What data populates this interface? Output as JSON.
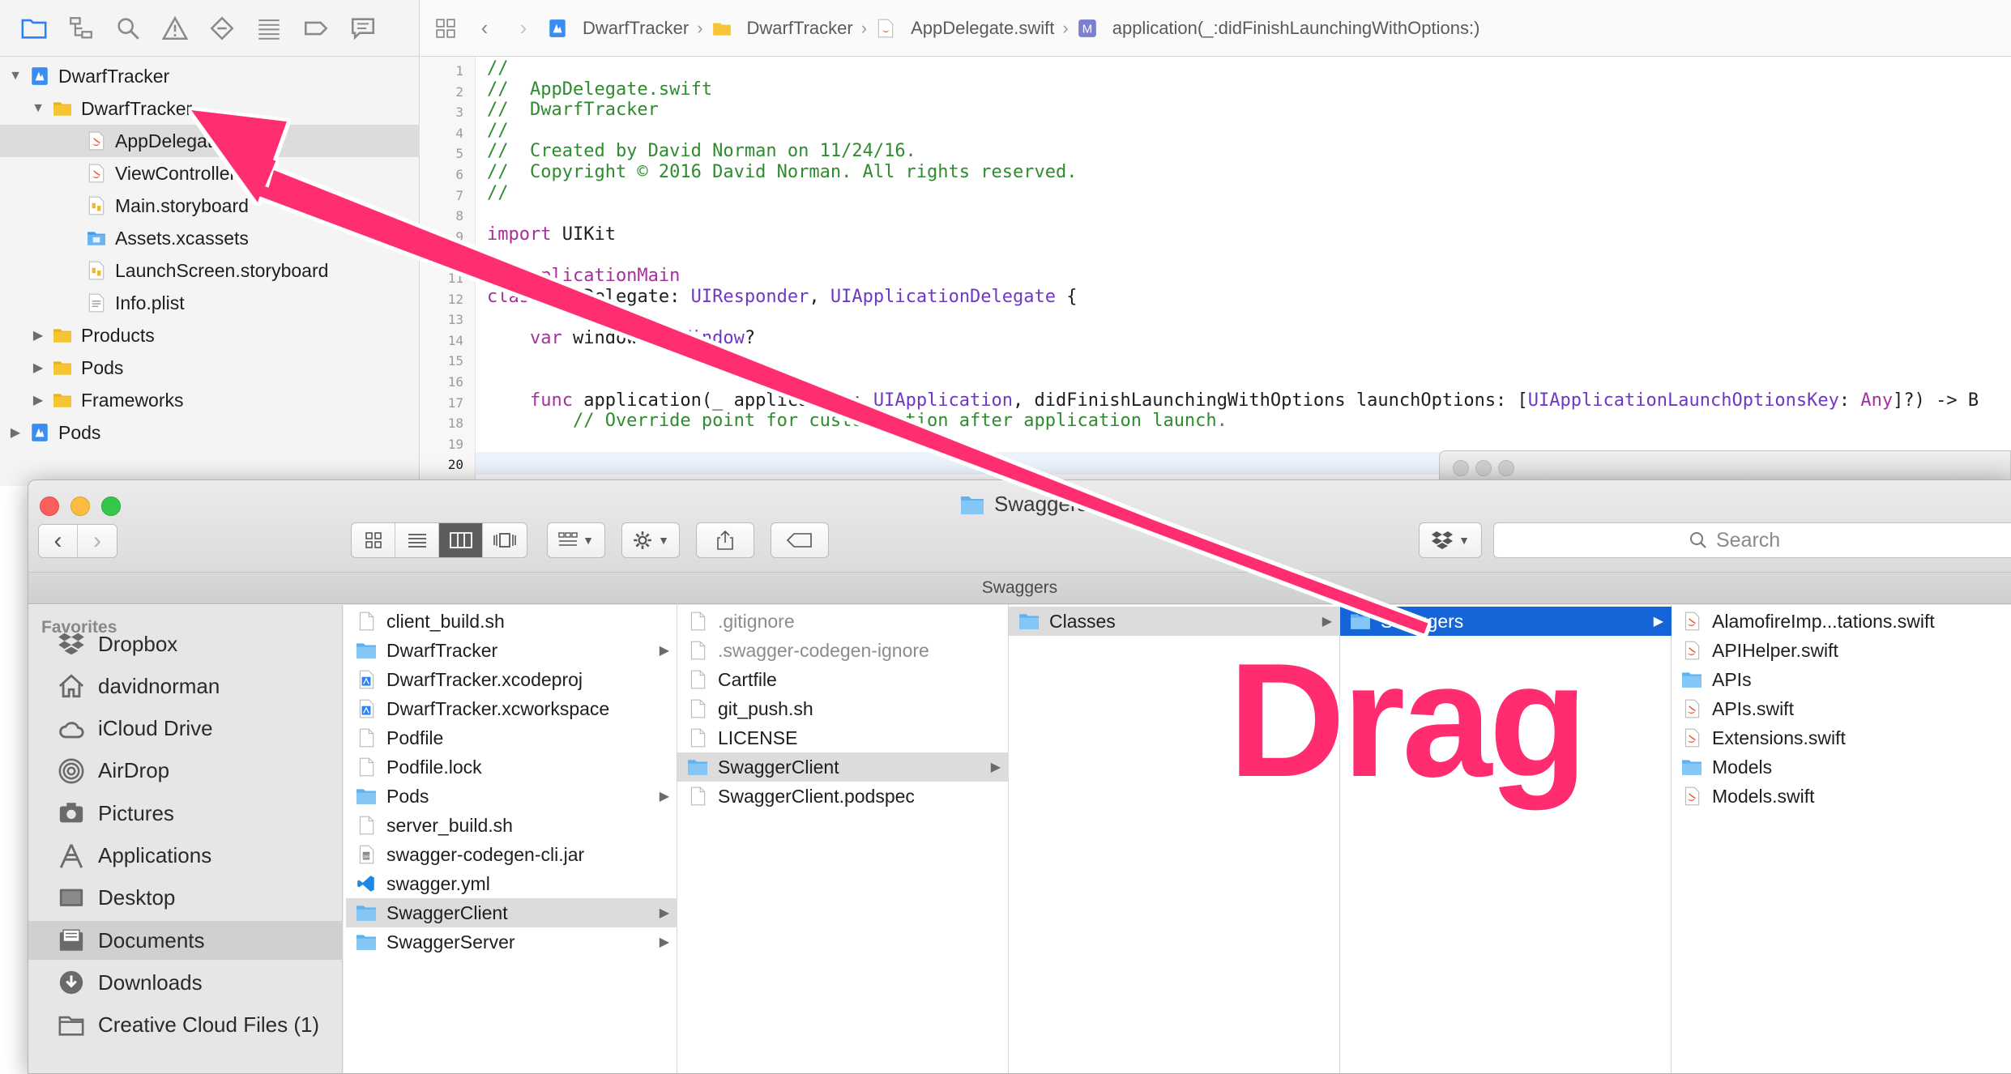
{
  "xcode": {
    "tree": [
      {
        "label": "DwarfTracker",
        "level": 0,
        "disclosure": "open",
        "icon": "project-icon"
      },
      {
        "label": "DwarfTracker",
        "level": 1,
        "disclosure": "open",
        "icon": "folder-icon"
      },
      {
        "label": "AppDelegate.swift",
        "level": 2,
        "disclosure": "",
        "icon": "swift-file-icon",
        "selected": true
      },
      {
        "label": "ViewController.swift",
        "level": 2,
        "disclosure": "",
        "icon": "swift-file-icon"
      },
      {
        "label": "Main.storyboard",
        "level": 2,
        "disclosure": "",
        "icon": "storyboard-icon"
      },
      {
        "label": "Assets.xcassets",
        "level": 2,
        "disclosure": "",
        "icon": "assets-folder-icon"
      },
      {
        "label": "LaunchScreen.storyboard",
        "level": 2,
        "disclosure": "",
        "icon": "storyboard-icon"
      },
      {
        "label": "Info.plist",
        "level": 2,
        "disclosure": "",
        "icon": "plist-icon"
      },
      {
        "label": "Products",
        "level": 1,
        "disclosure": "closed",
        "icon": "folder-icon"
      },
      {
        "label": "Pods",
        "level": 1,
        "disclosure": "closed",
        "icon": "folder-icon"
      },
      {
        "label": "Frameworks",
        "level": 1,
        "disclosure": "closed",
        "icon": "folder-icon"
      },
      {
        "label": "Pods",
        "level": 0,
        "disclosure": "closed",
        "icon": "project-icon"
      }
    ],
    "breadcrumb": [
      "DwarfTracker",
      "DwarfTracker",
      "AppDelegate.swift",
      "application(_:didFinishLaunchingWithOptions:)"
    ],
    "current_line": 20,
    "code": [
      {
        "n": 1,
        "parts": [
          [
            "c",
            "//"
          ]
        ]
      },
      {
        "n": 2,
        "parts": [
          [
            "c",
            "//  AppDelegate.swift"
          ]
        ]
      },
      {
        "n": 3,
        "parts": [
          [
            "c",
            "//  DwarfTracker"
          ]
        ]
      },
      {
        "n": 4,
        "parts": [
          [
            "c",
            "//"
          ]
        ]
      },
      {
        "n": 5,
        "parts": [
          [
            "c",
            "//  Created by David Norman on 11/24/16."
          ]
        ]
      },
      {
        "n": 6,
        "parts": [
          [
            "c",
            "//  Copyright © 2016 David Norman. All rights reserved."
          ]
        ]
      },
      {
        "n": 7,
        "parts": [
          [
            "c",
            "//"
          ]
        ]
      },
      {
        "n": 8,
        "parts": []
      },
      {
        "n": 9,
        "parts": [
          [
            "k",
            "import"
          ],
          [
            "p",
            " UIKit"
          ]
        ]
      },
      {
        "n": 10,
        "parts": []
      },
      {
        "n": 11,
        "parts": [
          [
            "k",
            "@UIApplicationMain"
          ]
        ]
      },
      {
        "n": 12,
        "parts": [
          [
            "k",
            "class"
          ],
          [
            "p",
            " AppDelegate: "
          ],
          [
            "t",
            "UIResponder"
          ],
          [
            "p",
            ", "
          ],
          [
            "t",
            "UIApplicationDelegate"
          ],
          [
            "p",
            " {"
          ]
        ]
      },
      {
        "n": 13,
        "parts": []
      },
      {
        "n": 14,
        "parts": [
          [
            "p",
            "    "
          ],
          [
            "k",
            "var"
          ],
          [
            "p",
            " window: "
          ],
          [
            "t",
            "UIWindow"
          ],
          [
            "p",
            "?"
          ]
        ]
      },
      {
        "n": 15,
        "parts": []
      },
      {
        "n": 16,
        "parts": []
      },
      {
        "n": 17,
        "parts": [
          [
            "p",
            "    "
          ],
          [
            "k",
            "func"
          ],
          [
            "p",
            " application(_ application: "
          ],
          [
            "t",
            "UIApplication"
          ],
          [
            "p",
            ", didFinishLaunchingWithOptions launchOptions: ["
          ],
          [
            "t",
            "UIApplicationLaunchOptionsKey"
          ],
          [
            "p",
            ": "
          ],
          [
            "k",
            "Any"
          ],
          [
            "p",
            "]?) -> B"
          ]
        ]
      },
      {
        "n": 18,
        "parts": [
          [
            "c",
            "        // Override point for customization after application launch."
          ]
        ]
      },
      {
        "n": 19,
        "parts": []
      },
      {
        "n": 20,
        "parts": []
      }
    ]
  },
  "finder": {
    "title": "Swaggers",
    "path_bar": "Swaggers",
    "search_placeholder": "Search",
    "favorites_heading": "Favorites",
    "sidebar": [
      {
        "label": "Dropbox",
        "icon": "dropbox-icon"
      },
      {
        "label": "davidnorman",
        "icon": "home-icon"
      },
      {
        "label": "iCloud Drive",
        "icon": "cloud-icon"
      },
      {
        "label": "AirDrop",
        "icon": "airdrop-icon"
      },
      {
        "label": "Pictures",
        "icon": "camera-icon"
      },
      {
        "label": "Applications",
        "icon": "applications-icon"
      },
      {
        "label": "Desktop",
        "icon": "desktop-icon"
      },
      {
        "label": "Documents",
        "icon": "documents-icon",
        "selected": true
      },
      {
        "label": "Downloads",
        "icon": "downloads-icon"
      },
      {
        "label": "Creative Cloud Files (1)",
        "icon": "folder-outline-icon"
      }
    ],
    "columns": [
      [
        {
          "label": "client_build.sh",
          "icon": "doc"
        },
        {
          "label": "DwarfTracker",
          "icon": "folder",
          "arrow": true
        },
        {
          "label": "DwarfTracker.xcodeproj",
          "icon": "xcode"
        },
        {
          "label": "DwarfTracker.xcworkspace",
          "icon": "xcode"
        },
        {
          "label": "Podfile",
          "icon": "doc"
        },
        {
          "label": "Podfile.lock",
          "icon": "doc"
        },
        {
          "label": "Pods",
          "icon": "folder",
          "arrow": true
        },
        {
          "label": "server_build.sh",
          "icon": "doc"
        },
        {
          "label": "swagger-codegen-cli.jar",
          "icon": "jar"
        },
        {
          "label": "swagger.yml",
          "icon": "vscode"
        },
        {
          "label": "SwaggerClient",
          "icon": "folder",
          "arrow": true,
          "state": "gray"
        },
        {
          "label": "SwaggerServer",
          "icon": "folder",
          "arrow": true
        }
      ],
      [
        {
          "label": ".gitignore",
          "icon": "doc",
          "dim": true
        },
        {
          "label": ".swagger-codegen-ignore",
          "icon": "doc",
          "dim": true
        },
        {
          "label": "Cartfile",
          "icon": "doc"
        },
        {
          "label": "git_push.sh",
          "icon": "doc"
        },
        {
          "label": "LICENSE",
          "icon": "doc"
        },
        {
          "label": "SwaggerClient",
          "icon": "folder",
          "arrow": true,
          "state": "gray"
        },
        {
          "label": "SwaggerClient.podspec",
          "icon": "doc"
        }
      ],
      [
        {
          "label": "Classes",
          "icon": "folder",
          "arrow": true,
          "state": "gray"
        }
      ],
      [
        {
          "label": "Swaggers",
          "icon": "folder",
          "arrow": true,
          "state": "blue"
        }
      ],
      [
        {
          "label": "AlamofireImp...tations.swift",
          "icon": "swift"
        },
        {
          "label": "APIHelper.swift",
          "icon": "swift"
        },
        {
          "label": "APIs",
          "icon": "folder"
        },
        {
          "label": "APIs.swift",
          "icon": "swift"
        },
        {
          "label": "Extensions.swift",
          "icon": "swift"
        },
        {
          "label": "Models",
          "icon": "folder"
        },
        {
          "label": "Models.swift",
          "icon": "swift"
        }
      ]
    ]
  },
  "annotation": {
    "text": "Drag",
    "color": "#ff2d6f"
  },
  "colors": {
    "selection_blue": "#1665d8",
    "folder_yellow": "#f7c531",
    "folder_blue": "#5eb2f0",
    "swift_orange": "#f05138"
  }
}
